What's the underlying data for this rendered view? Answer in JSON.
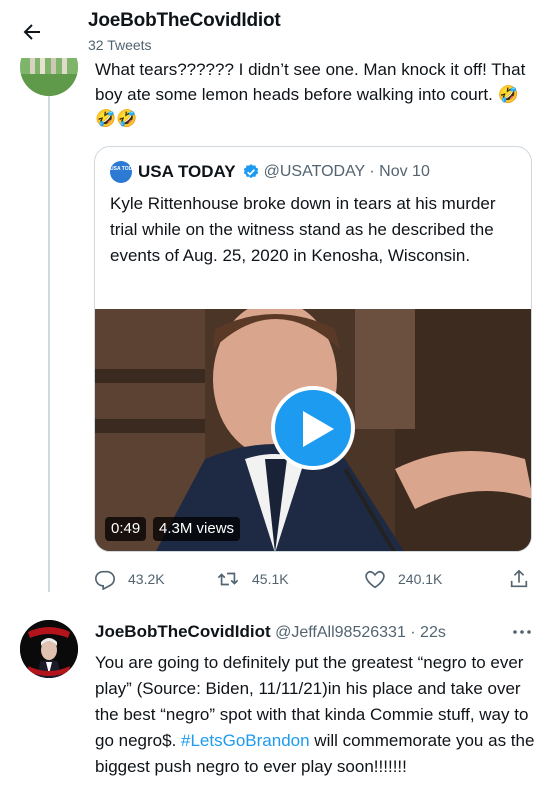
{
  "header": {
    "title": "JoeBobTheCovidIdiot",
    "subtitle": "32 Tweets"
  },
  "tweet1": {
    "text": "What tears?????? I didn’t see one. Man knock it off! That boy ate some lemon heads before walking into court. 🤣🤣🤣"
  },
  "quote": {
    "logo_text": "USA TODAY",
    "name": "USA TODAY",
    "handle_time": "@USATODAY · Nov 10",
    "text": "Kyle Rittenhouse broke down in tears at his murder trial while on the witness stand as he described the events of Aug. 25, 2020 in Kenosha, Wisconsin.",
    "video": {
      "duration": "0:49",
      "views": "4.3M views"
    }
  },
  "actions": {
    "replies": "43.2K",
    "retweets": "45.1K",
    "likes": "240.1K"
  },
  "tweet2": {
    "name": "JoeBobTheCovidIdiot",
    "handle_time": "@JeffAll98526331 · 22s",
    "text_before": "You are going to definitely put the greatest “negro to ever play” (Source: Biden, 11/11/21)in  his place and take over the best “negro” spot with that kinda Commie stuff, way to go negro$. ",
    "hashtag": "#LetsGoBrandon",
    "text_after": " will commemorate you as the biggest push negro to ever play soon!!!!!!!"
  },
  "colors": {
    "accent": "#1d9bf0",
    "muted": "#536471",
    "border": "#cfd9de",
    "usatoday_blue": "#2d7ad4"
  },
  "icons": [
    "back-arrow-icon",
    "verified-badge-icon",
    "play-icon",
    "reply-icon",
    "retweet-icon",
    "like-icon",
    "share-icon",
    "more-icon"
  ]
}
